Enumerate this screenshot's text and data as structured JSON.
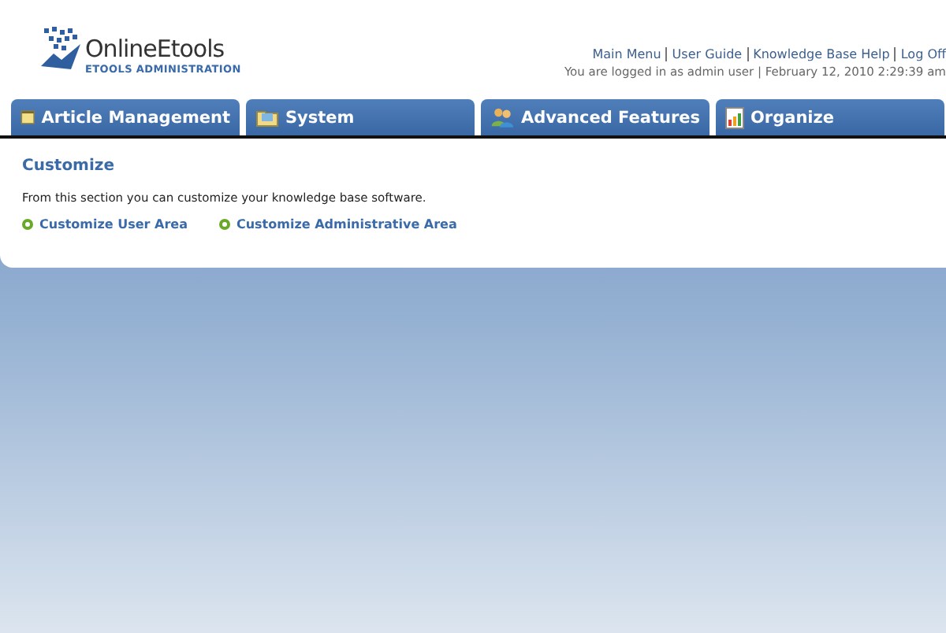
{
  "logo": {
    "name": "OnlineEtools",
    "subtitle": "ETOOLS ADMINISTRATION"
  },
  "top_links": [
    "Main Menu",
    "User Guide",
    "Knowledge Base Help",
    "Log Off"
  ],
  "login_status": "You are logged in as admin user | February 12, 2010 2:29:39 am",
  "tabs": [
    {
      "label": "Article Management",
      "kind": "notepad"
    },
    {
      "label": "System",
      "kind": "folder"
    },
    {
      "label": "Advanced Features",
      "kind": "users"
    },
    {
      "label": "Organize",
      "kind": "chart"
    }
  ],
  "section": {
    "title": "Customize",
    "description": "From this section you can customize your knowledge base software.",
    "links": [
      "Customize User Area",
      "Customize Administrative Area"
    ]
  }
}
